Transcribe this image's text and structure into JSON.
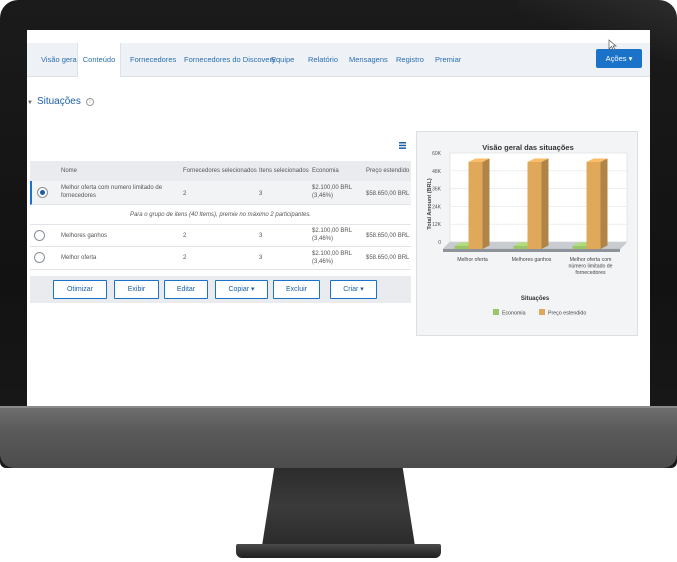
{
  "tabs": [
    {
      "label": "Visão geral",
      "active": false
    },
    {
      "label": "Conteúdo",
      "active": true
    },
    {
      "label": "Fornecedores",
      "active": false
    },
    {
      "label": "Fornecedores do Discovery",
      "active": false
    },
    {
      "label": "Equipe",
      "active": false
    },
    {
      "label": "Relatório",
      "active": false
    },
    {
      "label": "Mensagens",
      "active": false
    },
    {
      "label": "Registro",
      "active": false
    },
    {
      "label": "Premiar",
      "active": false
    }
  ],
  "actions_button": "Ações ▾",
  "section": {
    "title": "Situações",
    "info": "i"
  },
  "table": {
    "headers": [
      "Nome",
      "Fornecedores selecionados",
      "Itens selecionados",
      "Economia",
      "Preço estendido"
    ],
    "rows": [
      {
        "selected": true,
        "name": "Melhor oferta com numero limitado de fornecedores",
        "suppliers": "2",
        "items": "3",
        "economy": "$2.100,00 BRL (3,46%)",
        "price": "$58.650,00 BRL"
      },
      {
        "selected": false,
        "name": "Melhores ganhos",
        "suppliers": "2",
        "items": "3",
        "economy": "$2.100,00 BRL (3,46%)",
        "price": "$58.650,00 BRL"
      },
      {
        "selected": false,
        "name": "Melhor oferta",
        "suppliers": "2",
        "items": "3",
        "economy": "$2.100,00 BRL (3,46%)",
        "price": "$58.650,00 BRL"
      }
    ],
    "note": "Para o grupo de itens (40 Items), premie no máximo 2 participantes."
  },
  "buttons": [
    "Otimizar",
    "Exibir",
    "Editar",
    "Copiar ▾",
    "Excluir",
    "Criar ▾"
  ],
  "chart_data": {
    "type": "bar",
    "title": "Visão geral das situações",
    "xlabel": "Situações",
    "ylabel": "Total Amount (BRL)",
    "categories": [
      "Melhor oferta",
      "Melhores ganhos",
      "Melhor oferta com número limitado de fornecedores"
    ],
    "category_lines": [
      [
        "Melhor oferta"
      ],
      [
        "Melhores ganhos"
      ],
      [
        "Melhor oferta com",
        "número limitado de",
        "fornecedores"
      ]
    ],
    "ylim": [
      0,
      60000
    ],
    "yticks": [
      "0",
      "12K",
      "24K",
      "36K",
      "48K",
      "60K"
    ],
    "ytick_values": [
      0,
      12000,
      24000,
      36000,
      48000,
      60000
    ],
    "grid": true,
    "legend": "bottom",
    "series": [
      {
        "name": "Economia",
        "color": "#9cc56a",
        "values": [
          2100,
          2100,
          2100
        ]
      },
      {
        "name": "Preço estendido",
        "color": "#e0a95a",
        "values": [
          58650,
          58650,
          58650
        ]
      }
    ]
  }
}
